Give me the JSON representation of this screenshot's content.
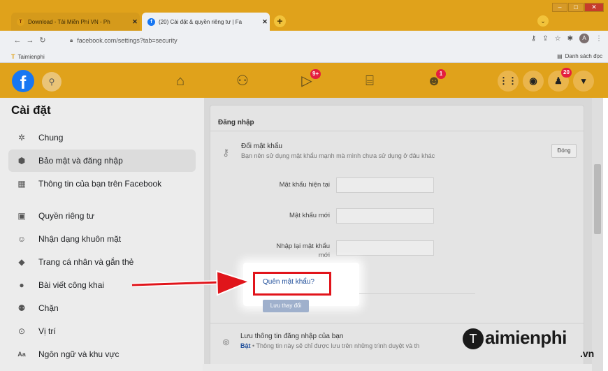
{
  "browser": {
    "tabs": [
      {
        "title": "Download - Tải Miễn Phí VN - Ph",
        "favicon": "T"
      },
      {
        "title": "(20) Cài đặt & quyền riêng tư | Fa",
        "favicon": "f"
      }
    ],
    "new_tab": "+",
    "url": "facebook.com/settings?tab=security",
    "bookmark_left": "Taimienphi",
    "bookmark_right": "Danh sách đọc"
  },
  "fb": {
    "logo": "f",
    "badges": {
      "watch": "9+",
      "groups": "1",
      "notifications": "20"
    }
  },
  "sidebar": {
    "title": "Cài đặt",
    "items": [
      {
        "label": "Chung",
        "icon": "gear-icon"
      },
      {
        "label": "Bảo mật và đăng nhập",
        "icon": "shield-icon"
      },
      {
        "label": "Thông tin của bạn trên Facebook",
        "icon": "grid-icon"
      },
      {
        "label": "Quyền riêng tư",
        "icon": "lock-icon"
      },
      {
        "label": "Nhận dạng khuôn mặt",
        "icon": "face-icon"
      },
      {
        "label": "Trang cá nhân và gắn thẻ",
        "icon": "tag-icon"
      },
      {
        "label": "Bài viết công khai",
        "icon": "globe-icon"
      },
      {
        "label": "Chặn",
        "icon": "block-icon"
      },
      {
        "label": "Vị trí",
        "icon": "pin-icon"
      },
      {
        "label": "Ngôn ngữ và khu vực",
        "icon": "language-icon"
      }
    ]
  },
  "main": {
    "section_title": "Đăng nhập",
    "change_password_title": "Đổi mật khẩu",
    "change_password_desc": "Bạn nên sử dụng mật khẩu mạnh mà mình chưa sử dụng ở đâu khác",
    "close_label": "Đóng",
    "current_password_label": "Mật khẩu hiện tại",
    "new_password_label": "Mật khẩu mới",
    "retype_password_label_1": "Nhập lại mật khẩu",
    "retype_password_label_2": "mới",
    "forgot_password": "Quên mật khẩu?",
    "save_changes": "Lưu thay đổi",
    "save_login_title": "Lưu thông tin đăng nhập của bạn",
    "save_login_on": "Bật",
    "save_login_desc": " • Thông tin này sẽ chỉ được lưu trên những trình duyệt và th"
  },
  "watermark": {
    "main": "aimienphi",
    "logo": "T",
    "sub": ".vn"
  }
}
